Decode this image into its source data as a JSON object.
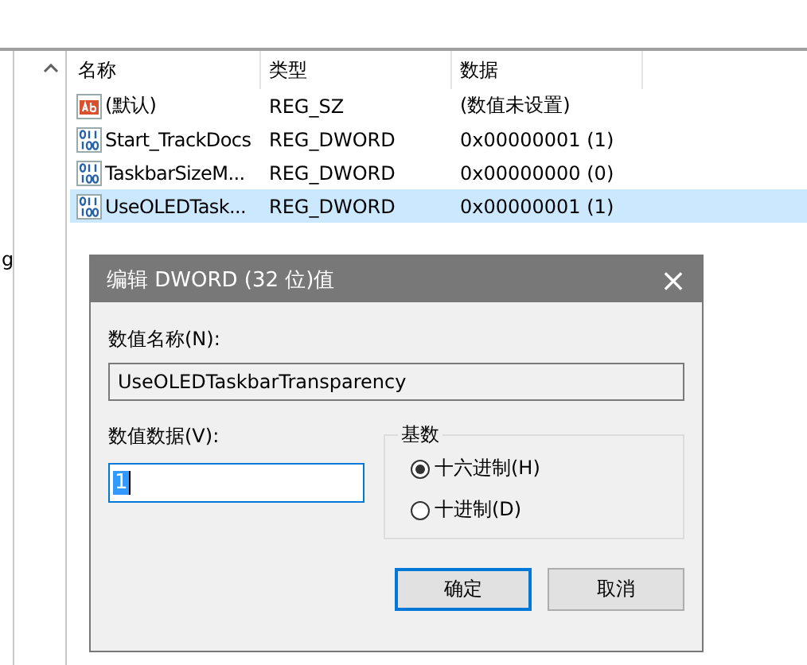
{
  "tree": {
    "items": [
      {
        "label": "g"
      }
    ]
  },
  "list": {
    "columns": [
      "名称",
      "类型",
      "数据"
    ],
    "rows": [
      {
        "kind": "string",
        "name": "(默认)",
        "type": "REG_SZ",
        "data": "(数值未设置)",
        "selected": false
      },
      {
        "kind": "dword",
        "name": "Start_TrackDocs",
        "type": "REG_DWORD",
        "data": "0x00000001 (1)",
        "selected": false
      },
      {
        "kind": "dword",
        "name": "TaskbarSizeM...",
        "type": "REG_DWORD",
        "data": "0x00000000 (0)",
        "selected": false
      },
      {
        "kind": "dword",
        "name": "UseOLEDTask...",
        "type": "REG_DWORD",
        "data": "0x00000001 (1)",
        "selected": true
      }
    ]
  },
  "dialog": {
    "title": "编辑 DWORD (32 位)值",
    "close": "×",
    "name_label": "数值名称(N):",
    "name_value": "UseOLEDTaskbarTransparency",
    "data_label": "数值数据(V):",
    "data_value": "1",
    "data_value_selected": true,
    "base": {
      "title": "基数",
      "options": [
        {
          "label": "十六进制(H)",
          "selected": true
        },
        {
          "label": "十进制(D)",
          "selected": false
        }
      ]
    },
    "buttons": [
      {
        "label": "确定",
        "default": true
      },
      {
        "label": "取消",
        "default": false
      }
    ]
  }
}
